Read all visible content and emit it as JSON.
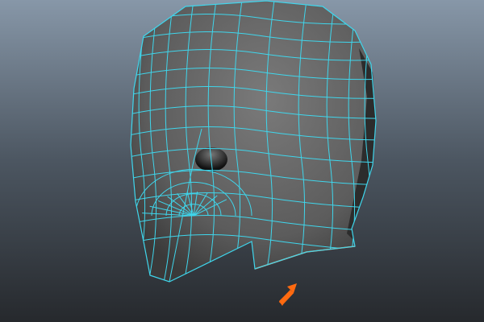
{
  "viewport": {
    "background_top": "#8797a8",
    "background_bottom": "#26292d",
    "mesh_fill": "#6a6a6a",
    "wire_color": "#3fd6ec",
    "selected_edge_color": "#f0a070",
    "pointer_color": "#ff6a10",
    "pointer_icon": "arrow-up-right-icon",
    "model": "head-mesh"
  }
}
